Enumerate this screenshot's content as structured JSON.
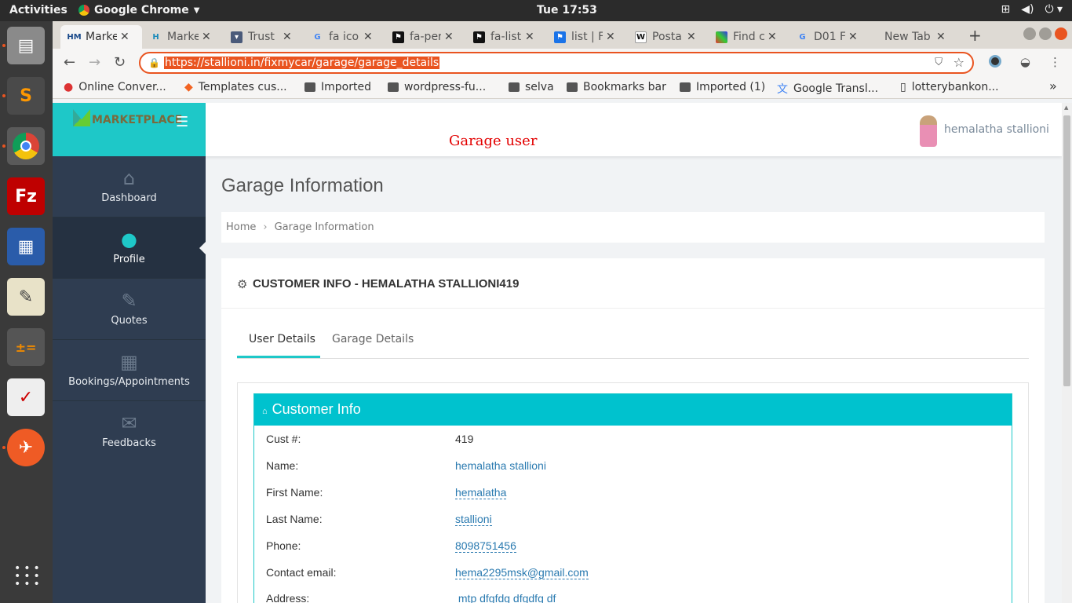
{
  "os": {
    "activities": "Activities",
    "app_name": "Google Chrome",
    "clock": "Tue 17:53"
  },
  "browser": {
    "tabs": [
      {
        "label": "Marke",
        "icon": "HM",
        "active": true
      },
      {
        "label": "Marke",
        "icon": "H"
      },
      {
        "label": "Trust",
        "icon": "shield"
      },
      {
        "label": "fa ico",
        "icon": "G"
      },
      {
        "label": "fa-per",
        "icon": "flag"
      },
      {
        "label": "fa-list",
        "icon": "flag"
      },
      {
        "label": "list | F",
        "icon": "flag"
      },
      {
        "label": "Posta",
        "icon": "W"
      },
      {
        "label": "Find c",
        "icon": "grid"
      },
      {
        "label": "D01 F",
        "icon": "G"
      },
      {
        "label": "New Tab",
        "icon": ""
      }
    ],
    "url": "https://stallioni.in/fixmycar/garage/garage_details",
    "bookmarks": [
      "Online Conver...",
      "Templates cus...",
      "Imported",
      "wordpress-fu...",
      "selva",
      "Bookmarks bar",
      "Imported (1)",
      "Google Transl...",
      "lotterybankon..."
    ],
    "bookmarks_more": "»"
  },
  "app": {
    "logo_text": "MARKETPLACE",
    "header_title": "Garage user",
    "user_name": "hemalatha stallioni",
    "sidebar": [
      {
        "label": "Dashboard",
        "icon": "home-icon"
      },
      {
        "label": "Profile",
        "icon": "user-icon",
        "active": true
      },
      {
        "label": "Quotes",
        "icon": "edit-icon"
      },
      {
        "label": "Bookings/Appointments",
        "icon": "calendar-icon"
      },
      {
        "label": "Feedbacks",
        "icon": "chat-icon"
      }
    ],
    "page_title": "Garage Information",
    "breadcrumb": {
      "home": "Home",
      "current": "Garage Information"
    },
    "panel_title": "CUSTOMER INFO - HEMALATHA STALLIONI419",
    "tabs": {
      "user": "User Details",
      "garage": "Garage Details"
    },
    "customer_info": {
      "title": "Customer Info",
      "fields": [
        {
          "label": "Cust #:",
          "value": "419"
        },
        {
          "label": "Name:",
          "value": "hemalatha stallioni"
        },
        {
          "label": "First Name:",
          "value": "hemalatha"
        },
        {
          "label": "Last Name:",
          "value": "stallioni"
        },
        {
          "label": "Phone:",
          "value": "8098751456"
        },
        {
          "label": "Contact email:",
          "value": "hema2295msk@gmail.com"
        },
        {
          "label": "Address:",
          "value": " mtp dfgfdg dfgdfg df"
        }
      ]
    }
  }
}
